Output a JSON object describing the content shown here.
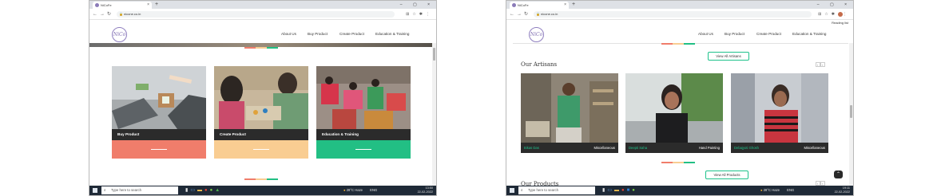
{
  "browser": {
    "tab_title": "NiCoFe",
    "tab_close": "×",
    "new_tab": "+",
    "window_controls": "– ▢ ×",
    "url": "nicone.co.in",
    "back": "←",
    "forward": "→",
    "reload": "↻",
    "reading_list": "Reading list"
  },
  "site": {
    "logo_text": "NiCo",
    "menu": [
      "About Us",
      "Buy Product",
      "Create Product",
      "Education & Training"
    ]
  },
  "left_page": {
    "cards": [
      {
        "label": "Buy Product",
        "color": "#f07d6b"
      },
      {
        "label": "Create Product",
        "color": "#f9cd92"
      },
      {
        "label": "Education & Training",
        "color": "#22bf84"
      }
    ]
  },
  "right_page": {
    "artisans_title": "Our Artisans",
    "view_artisans": "View All Artisans",
    "artisans": [
      {
        "name": "Bikas Das",
        "category": "Miscellaneous"
      },
      {
        "name": "Deepti Saha",
        "category": "Hand Painting"
      },
      {
        "name": "Debajyoti Ghosh",
        "category": "Miscellaneous"
      }
    ],
    "products_title": "Our Products",
    "view_products": "View All Products",
    "to_top": "⌃"
  },
  "taskbar": {
    "search_placeholder": "Type here to search",
    "weather": "28°C Haze",
    "lang": "ENG",
    "left_time": "13:50",
    "left_date": "22-02-2022",
    "right_time": "19:11",
    "right_date": "22-02-2022"
  },
  "colors": {
    "accent_green": "#1ec28b",
    "coral": "#f07d6b",
    "peach": "#f9cd92",
    "green": "#22bf84",
    "dark_bar": "#2b2b2b"
  }
}
